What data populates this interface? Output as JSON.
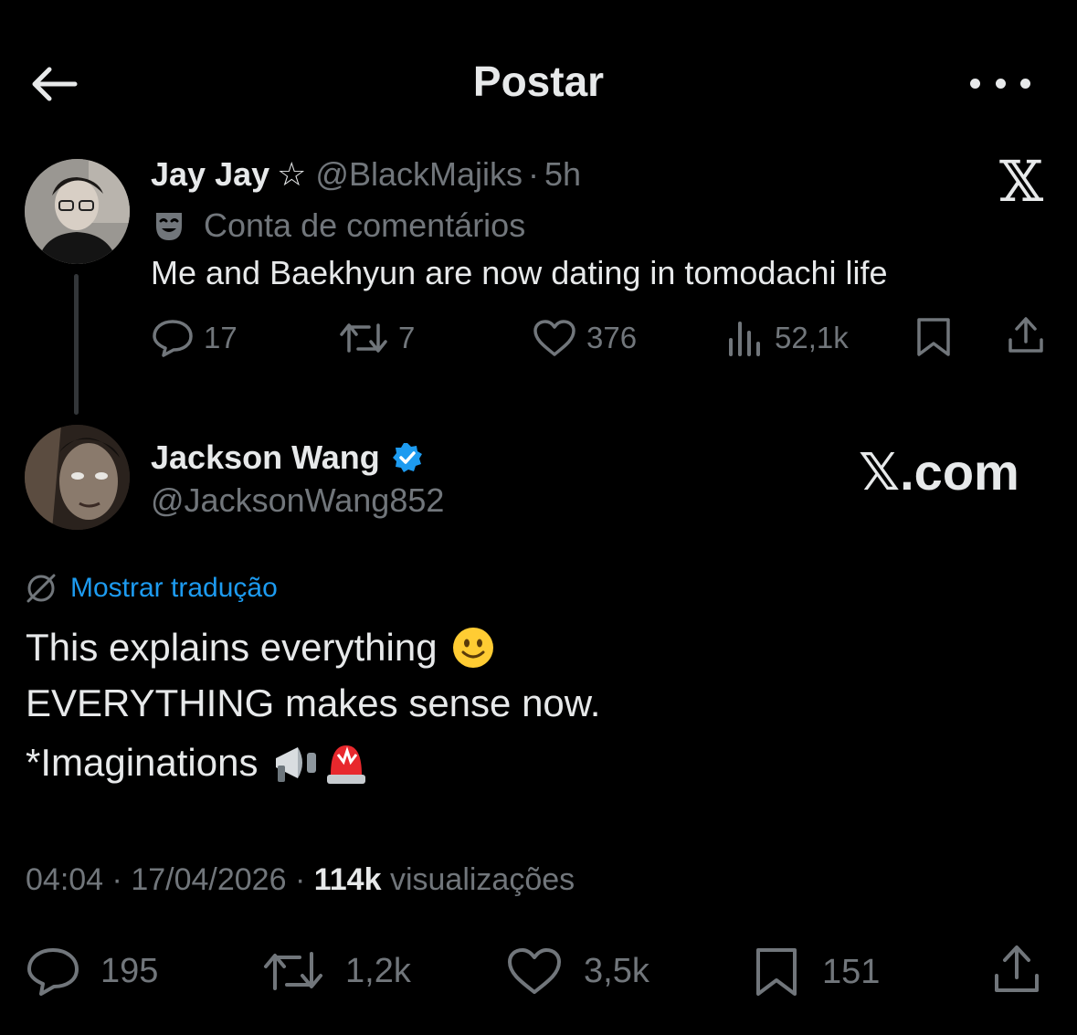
{
  "header": {
    "title": "Postar",
    "back_icon": "arrow-left-icon",
    "more_icon": "more-horizontal-icon"
  },
  "reply": {
    "display_name": "Jay Jay",
    "star": "☆",
    "handle": "@BlackMajiks",
    "separator": "·",
    "time": "5h",
    "account_label": "Conta de comentários",
    "text": "Me and Baekhyun are now dating in tomodachi life",
    "logo": "𝕏",
    "stats": {
      "replies": "17",
      "reposts": "7",
      "likes": "376",
      "views": "52,1k"
    }
  },
  "post": {
    "display_name": "Jackson Wang",
    "handle": "@JacksonWang852",
    "watermark": "𝕏.com",
    "translate_label": "Mostrar tradução",
    "lines": [
      "This explains everything",
      "EVERYTHING makes sense now.",
      "*Imaginations"
    ],
    "time": "04:04",
    "date": "17/04/2026",
    "separator": "·",
    "views_count": "114k",
    "views_label": "visualizações",
    "stats": {
      "replies": "195",
      "reposts": "1,2k",
      "likes": "3,5k",
      "bookmarks": "151"
    }
  },
  "colors": {
    "background": "#000000",
    "text": "#e7e9ea",
    "muted": "#71767b",
    "link": "#1d9bf0",
    "verified": "#1d9bf0"
  }
}
